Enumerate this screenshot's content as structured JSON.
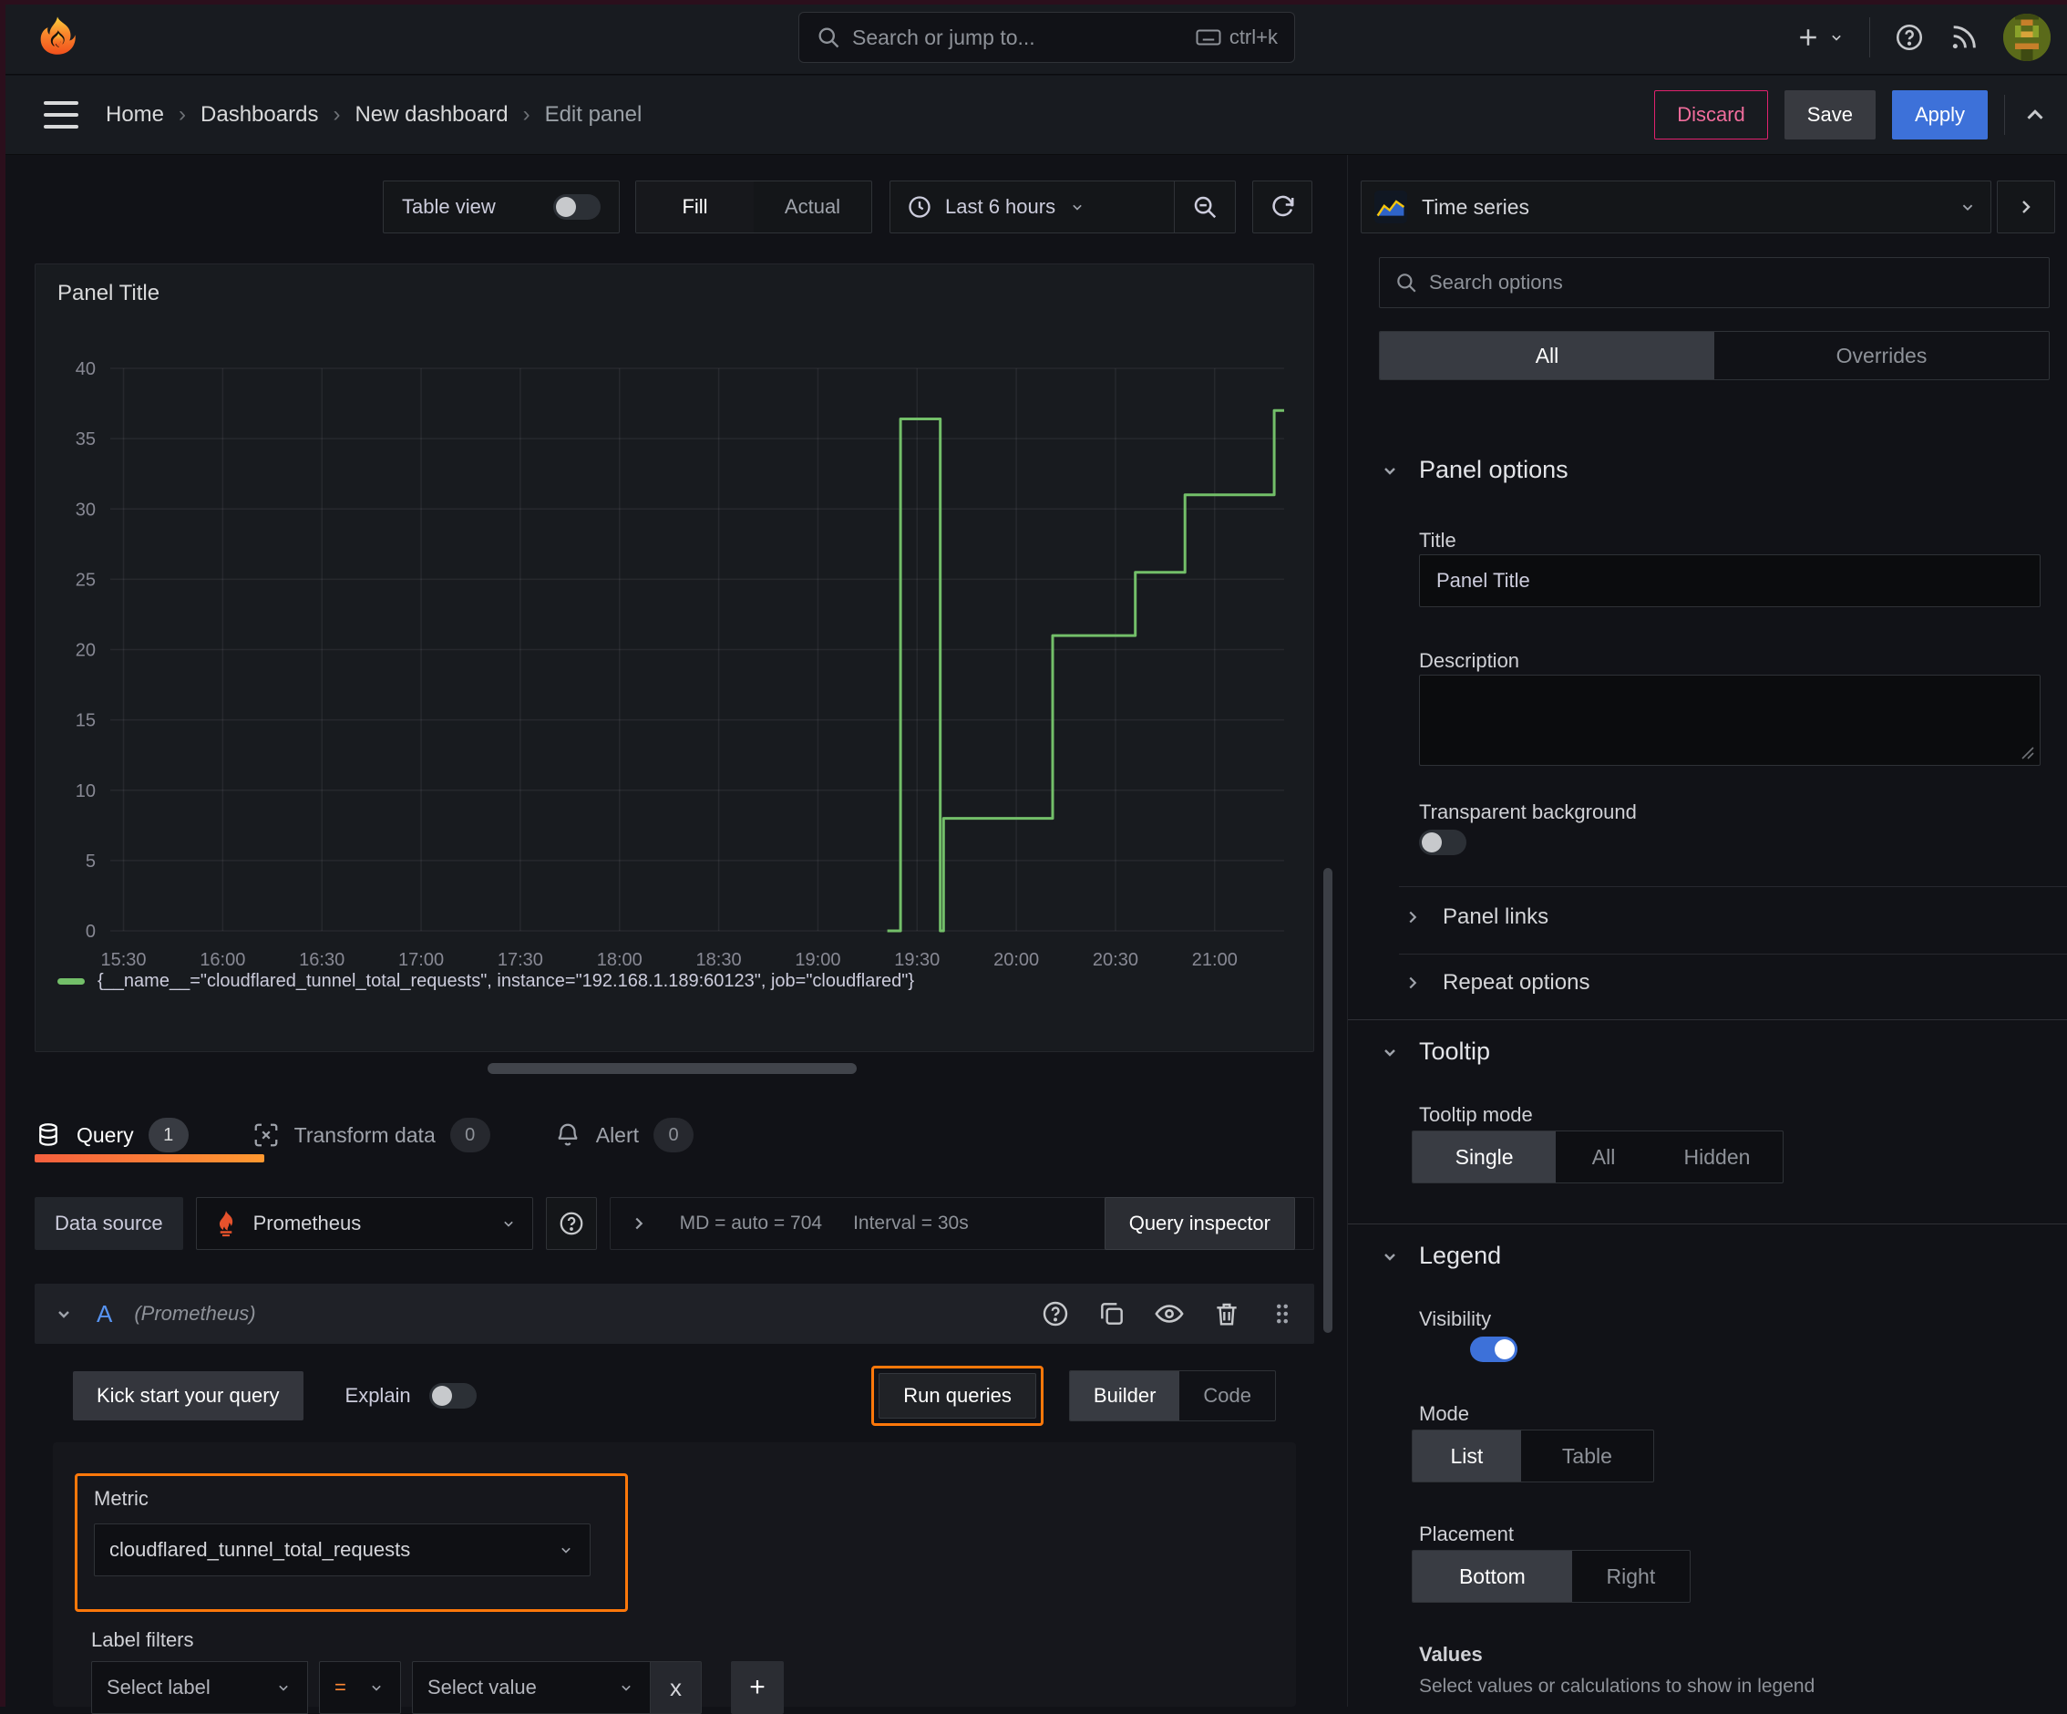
{
  "topnav": {
    "search_placeholder": "Search or jump to...",
    "search_shortcut": "ctrl+k"
  },
  "breadcrumb": {
    "items": [
      "Home",
      "Dashboards",
      "New dashboard",
      "Edit panel"
    ],
    "discard_label": "Discard",
    "save_label": "Save",
    "apply_label": "Apply"
  },
  "toolbar": {
    "table_view_label": "Table view",
    "fill_label": "Fill",
    "actual_label": "Actual",
    "time_range_label": "Last 6 hours"
  },
  "panel": {
    "title": "Panel Title"
  },
  "chart_data": {
    "type": "line",
    "line_style": "step-after",
    "title": "Panel Title",
    "xlabel": "",
    "ylabel": "",
    "ylim": [
      0,
      40
    ],
    "y_ticks": [
      0,
      5,
      10,
      15,
      20,
      25,
      30,
      35,
      40
    ],
    "x_ticks": [
      "15:30",
      "16:00",
      "16:30",
      "17:00",
      "17:30",
      "18:00",
      "18:30",
      "19:00",
      "19:30",
      "20:00",
      "20:30",
      "21:00"
    ],
    "x_range": [
      "15:26",
      "21:21"
    ],
    "grid": true,
    "legend_position": "bottom",
    "series": [
      {
        "name": "{__name__=\"cloudflared_tunnel_total_requests\", instance=\"192.168.1.189:60123\", job=\"cloudflared\"}",
        "color": "#73bf69",
        "points": [
          {
            "t": "19:21",
            "v": 0
          },
          {
            "t": "19:25",
            "v": 36.4
          },
          {
            "t": "19:37",
            "v": 0
          },
          {
            "t": "19:38",
            "v": 8
          },
          {
            "t": "20:11",
            "v": 21
          },
          {
            "t": "20:36",
            "v": 25.5
          },
          {
            "t": "20:51",
            "v": 31
          },
          {
            "t": "21:18",
            "v": 37
          }
        ]
      }
    ]
  },
  "tabs": {
    "query_label": "Query",
    "query_count": "1",
    "transform_label": "Transform data",
    "transform_count": "0",
    "alert_label": "Alert",
    "alert_count": "0"
  },
  "datasource_row": {
    "label": "Data source",
    "value": "Prometheus",
    "md_stat": "MD = auto = 704",
    "interval_stat": "Interval = 30s",
    "inspector_label": "Query inspector"
  },
  "query_editor": {
    "ref_id": "A",
    "datasource_hint": "(Prometheus)",
    "kick_start_label": "Kick start your query",
    "explain_label": "Explain",
    "run_queries_label": "Run queries",
    "builder_label": "Builder",
    "code_label": "Code",
    "metric_label": "Metric",
    "metric_value": "cloudflared_tunnel_total_requests",
    "label_filters_label": "Label filters",
    "select_label_placeholder": "Select label",
    "operator": "=",
    "select_value_placeholder": "Select value",
    "remove_filter_label": "x",
    "add_filter_label": "+"
  },
  "options_panel": {
    "viz_type": "Time series",
    "search_placeholder": "Search options",
    "tab_all": "All",
    "tab_overrides": "Overrides",
    "panel_options": {
      "title": "Panel options",
      "title_label": "Title",
      "title_value": "Panel Title",
      "description_label": "Description",
      "transparent_label": "Transparent background"
    },
    "panel_links_label": "Panel links",
    "repeat_options_label": "Repeat options",
    "tooltip": {
      "title": "Tooltip",
      "mode_label": "Tooltip mode",
      "options": [
        "Single",
        "All",
        "Hidden"
      ],
      "selected": "Single"
    },
    "legend": {
      "title": "Legend",
      "visibility_label": "Visibility",
      "mode_label": "Mode",
      "mode_options": [
        "List",
        "Table"
      ],
      "placement_label": "Placement",
      "placement_options": [
        "Bottom",
        "Right"
      ],
      "values_label": "Values",
      "values_help": "Select values or calculations to show in legend"
    }
  },
  "colors": {
    "accent_orange": "#ff780a",
    "series_green": "#73bf69",
    "primary_blue": "#3d71d9",
    "destructive_pink": "#e0226e"
  }
}
